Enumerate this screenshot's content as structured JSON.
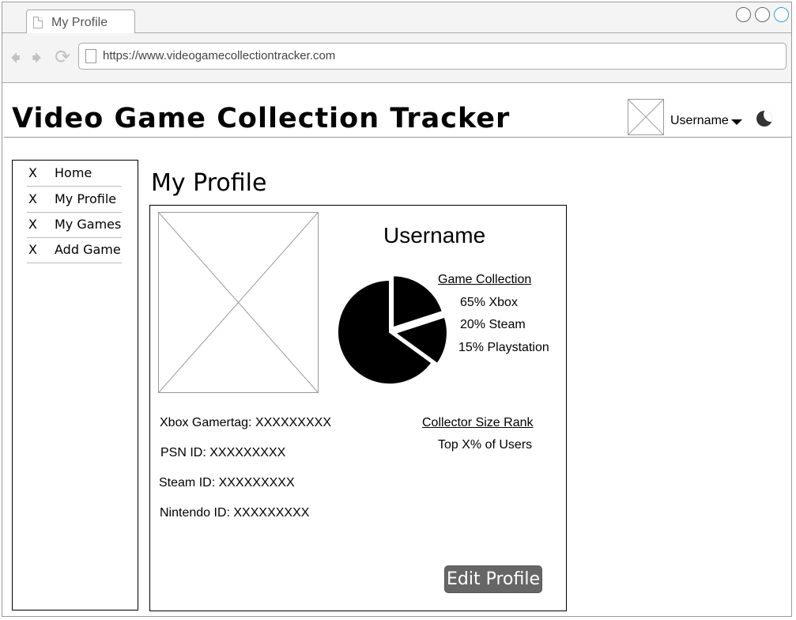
{
  "browser": {
    "tab_title": "My Profile",
    "url": "https://www.videogamecollectiontracker.com"
  },
  "header": {
    "app_title": "Video Game Collection Tracker",
    "username": "Username"
  },
  "sidebar": {
    "items": [
      {
        "marker": "X",
        "label": "Home"
      },
      {
        "marker": "X",
        "label": "My Profile"
      },
      {
        "marker": "X",
        "label": "My Games"
      },
      {
        "marker": "X",
        "label": "Add Game"
      }
    ]
  },
  "main": {
    "page_title": "My Profile",
    "profile": {
      "username": "Username",
      "collection_heading": "Game Collection",
      "collection": [
        {
          "label": "65% Xbox",
          "percent": 65
        },
        {
          "label": "20% Steam",
          "percent": 20
        },
        {
          "label": "15% Playstation",
          "percent": 15
        }
      ],
      "ids": [
        "Xbox Gamertag: XXXXXXXXX",
        "PSN ID: XXXXXXXXX",
        "Steam ID: XXXXXXXXX",
        "Nintendo ID: XXXXXXXXX"
      ],
      "rank_heading": "Collector Size Rank",
      "rank_value": "Top X% of Users",
      "edit_button": "Edit Profile"
    }
  },
  "icons": {
    "back": "arrow-left-icon",
    "forward": "arrow-right-icon",
    "reload": "reload-icon",
    "theme": "moon-icon"
  }
}
